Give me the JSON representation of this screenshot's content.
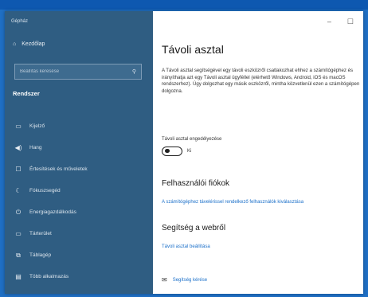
{
  "window": {
    "title": "Gépház"
  },
  "sidebar": {
    "home_label": "Kezdőlap",
    "search_placeholder": "Beállítás keresése",
    "section_title": "Rendszer",
    "items": [
      {
        "icon": "monitor-icon",
        "label": "Kijelző"
      },
      {
        "icon": "speaker-icon",
        "label": "Hang"
      },
      {
        "icon": "notification-icon",
        "label": "Értesítések és műveletek"
      },
      {
        "icon": "moon-icon",
        "label": "Fókuszsegéd"
      },
      {
        "icon": "power-icon",
        "label": "Energiagazdálkodás"
      },
      {
        "icon": "battery-icon",
        "label": "Tárterület"
      },
      {
        "icon": "tablet-icon",
        "label": "Táblagép"
      },
      {
        "icon": "multitasking-icon",
        "label": "Több alkalmazás"
      }
    ]
  },
  "content": {
    "title": "Távoli asztal",
    "description": "A Távoli asztal segítségével egy távoli eszközről csatlakozhat ehhez a számítógéphez és irányíthatja azt egy Távoli asztal ügyféllel (elérhető Windows, Android, iOS és macOS rendszerhez). Úgy dolgozhat egy másik eszközről, mintha közvetlenül ezen a számítógépen dolgozna.",
    "toggle_label": "Távoli asztal engedélyezése",
    "toggle_state": "Ki",
    "toggle_on": false,
    "user_accounts_heading": "Felhasználói fiókok",
    "user_accounts_link": "A számítógéphez távelérissel rendelkező felhasználók kiválasztása",
    "web_help_heading": "Segítség a webről",
    "web_help_link": "Távoli asztal beállítása",
    "get_help_link": "Segítség kérése"
  },
  "colors": {
    "sidebar_bg": "#2f5d82",
    "accent": "#1a6fc9",
    "desktop": "#1f6fc4"
  }
}
